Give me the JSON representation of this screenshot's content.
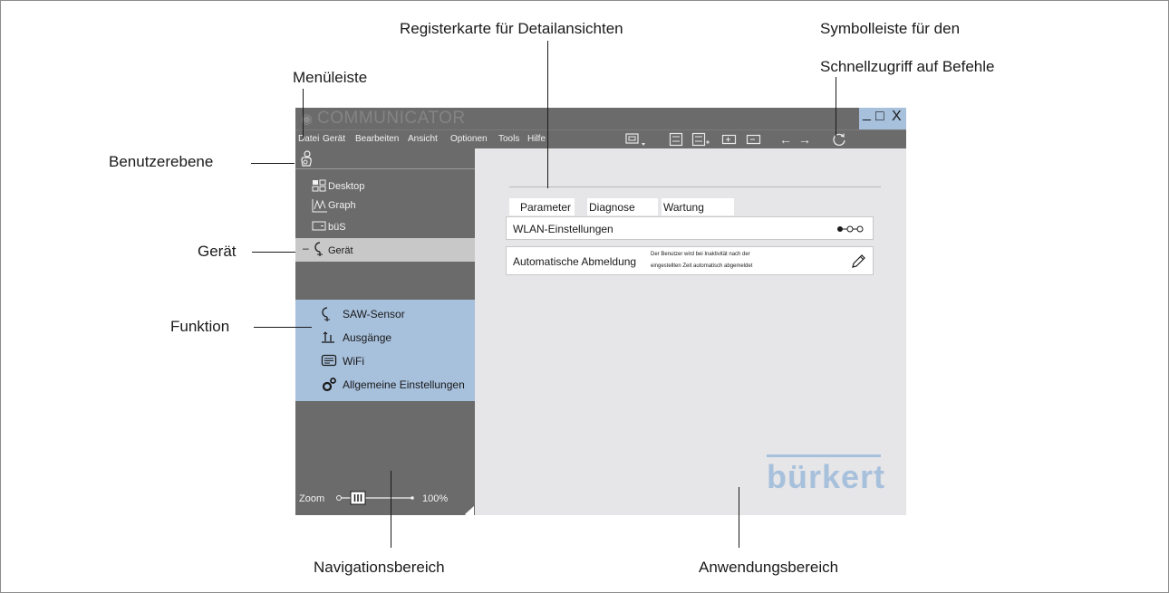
{
  "annotations": {
    "registerkarte": "Registerkarte für Detailansichten",
    "symbolleiste_1": "Symbolleiste für den",
    "symbolleiste_2": "Schnellzugriff auf Befehle",
    "menueleiste": "Menüleiste",
    "benutzerebene": "Benutzerebene",
    "geraet": "Gerät",
    "funktion": "Funktion",
    "navigationsbereich": "Navigationsbereich",
    "anwendungsbereich": "Anwendungsbereich"
  },
  "window": {
    "title": "COMMUNICATOR",
    "controls": {
      "minimize": "_",
      "maximize": "□",
      "close": "X"
    }
  },
  "menu": [
    "Datei",
    "Gerät",
    "Bearbeiten",
    "Ansicht",
    "Optionen",
    "Tools",
    "Hilfe"
  ],
  "toolbar": {
    "icons": [
      "device-menu-icon",
      "save-icon",
      "save-as-icon",
      "device-add-icon",
      "device-remove-icon",
      "back-icon",
      "forward-icon",
      "refresh-icon"
    ]
  },
  "navigation": {
    "items": [
      {
        "label": "Desktop",
        "icon": "desktop-icon"
      },
      {
        "label": "Graph",
        "icon": "graph-icon"
      },
      {
        "label": "büS",
        "icon": "bus-icon"
      }
    ],
    "device": {
      "label": "Gerät",
      "icon": "device-icon"
    },
    "sub_items": [
      {
        "label": "SAW-Sensor",
        "icon": "sensor-icon"
      },
      {
        "label": "Ausgänge",
        "icon": "outputs-icon"
      },
      {
        "label": "WiFi",
        "icon": "wifi-icon"
      },
      {
        "label": "Allgemeine Einstellungen",
        "icon": "settings-gears-icon"
      }
    ],
    "zoom": {
      "label": "Zoom",
      "value_text": "100%",
      "value": 100
    }
  },
  "content": {
    "tabs": [
      "Parameter",
      "Diagnose",
      "Wartung"
    ],
    "active_tab": "Parameter",
    "rows": [
      {
        "label": "WLAN-Einstellungen",
        "icon": "link-icon"
      },
      {
        "label": "Automatische Abmeldung",
        "description_1": "Der Benutzer wird bei Inaktivität nach der",
        "description_2": "eingestellten Zeit automatisch abgemeldet",
        "icon": "pencil-icon"
      }
    ],
    "brand": "bürkert"
  },
  "colors": {
    "titlebar": "#6b6b6b",
    "highlight": "#a7c0dc",
    "content_bg": "#e6e6e8",
    "selected": "#c8c8c8"
  }
}
